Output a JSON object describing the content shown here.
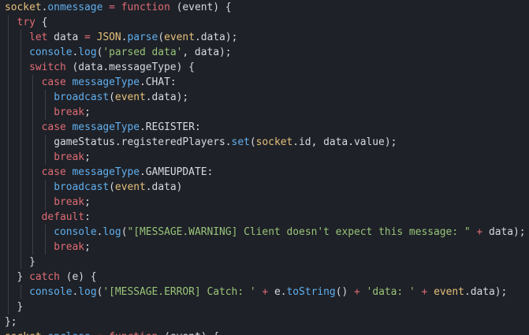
{
  "editor": {
    "language": "javascript",
    "colors": {
      "background": "#1e2127",
      "keyword": "#e06c75",
      "function": "#61afef",
      "object": "#e5c07b",
      "string": "#98c379",
      "text": "#d7dae0",
      "indent_guide": "#3b4048"
    },
    "lines": [
      {
        "indent": 0,
        "tokens": [
          {
            "t": "socket",
            "k": "obj"
          },
          {
            "t": ".",
            "k": "punc"
          },
          {
            "t": "onmessage",
            "k": "prop"
          },
          {
            "t": " ",
            "k": "punc"
          },
          {
            "t": "=",
            "k": "op"
          },
          {
            "t": " ",
            "k": "punc"
          },
          {
            "t": "function",
            "k": "kw"
          },
          {
            "t": " (event) {",
            "k": "punc"
          }
        ]
      },
      {
        "indent": 1,
        "tokens": [
          {
            "t": "try",
            "k": "kw"
          },
          {
            "t": " {",
            "k": "punc"
          }
        ]
      },
      {
        "indent": 2,
        "tokens": [
          {
            "t": "let",
            "k": "kw"
          },
          {
            "t": " data ",
            "k": "var"
          },
          {
            "t": "=",
            "k": "op"
          },
          {
            "t": " ",
            "k": "punc"
          },
          {
            "t": "JSON",
            "k": "obj"
          },
          {
            "t": ".",
            "k": "punc"
          },
          {
            "t": "parse",
            "k": "fn"
          },
          {
            "t": "(",
            "k": "punc"
          },
          {
            "t": "event",
            "k": "obj"
          },
          {
            "t": ".data);",
            "k": "punc"
          }
        ]
      },
      {
        "indent": 2,
        "tokens": [
          {
            "t": "console",
            "k": "fn"
          },
          {
            "t": ".",
            "k": "punc"
          },
          {
            "t": "log",
            "k": "fn"
          },
          {
            "t": "(",
            "k": "punc"
          },
          {
            "t": "'parsed data'",
            "k": "str"
          },
          {
            "t": ", data);",
            "k": "punc"
          }
        ]
      },
      {
        "indent": 2,
        "tokens": [
          {
            "t": "switch",
            "k": "kw"
          },
          {
            "t": " (data.messageType) {",
            "k": "punc"
          }
        ]
      },
      {
        "indent": 3,
        "tokens": [
          {
            "t": "case",
            "k": "kw"
          },
          {
            "t": " ",
            "k": "punc"
          },
          {
            "t": "messageType",
            "k": "prop"
          },
          {
            "t": ".CHAT:",
            "k": "punc"
          }
        ]
      },
      {
        "indent": 4,
        "tokens": [
          {
            "t": "broadcast",
            "k": "fn"
          },
          {
            "t": "(",
            "k": "punc"
          },
          {
            "t": "event",
            "k": "obj"
          },
          {
            "t": ".data);",
            "k": "punc"
          }
        ]
      },
      {
        "indent": 4,
        "tokens": [
          {
            "t": "break",
            "k": "kw"
          },
          {
            "t": ";",
            "k": "punc"
          }
        ]
      },
      {
        "indent": 3,
        "tokens": [
          {
            "t": "case",
            "k": "kw"
          },
          {
            "t": " ",
            "k": "punc"
          },
          {
            "t": "messageType",
            "k": "prop"
          },
          {
            "t": ".REGISTER:",
            "k": "punc"
          }
        ]
      },
      {
        "indent": 4,
        "tokens": [
          {
            "t": "gameStatus.registeredPlayers.",
            "k": "var"
          },
          {
            "t": "set",
            "k": "fn"
          },
          {
            "t": "(",
            "k": "punc"
          },
          {
            "t": "socket",
            "k": "obj"
          },
          {
            "t": ".id, data.value);",
            "k": "punc"
          }
        ]
      },
      {
        "indent": 4,
        "tokens": [
          {
            "t": "break",
            "k": "kw"
          },
          {
            "t": ";",
            "k": "punc"
          }
        ]
      },
      {
        "indent": 3,
        "tokens": [
          {
            "t": "case",
            "k": "kw"
          },
          {
            "t": " ",
            "k": "punc"
          },
          {
            "t": "messageType",
            "k": "prop"
          },
          {
            "t": ".GAMEUPDATE:",
            "k": "punc"
          }
        ]
      },
      {
        "indent": 4,
        "tokens": [
          {
            "t": "broadcast",
            "k": "fn"
          },
          {
            "t": "(",
            "k": "punc"
          },
          {
            "t": "event",
            "k": "obj"
          },
          {
            "t": ".data)",
            "k": "punc"
          }
        ]
      },
      {
        "indent": 4,
        "tokens": [
          {
            "t": "break",
            "k": "kw"
          },
          {
            "t": ";",
            "k": "punc"
          }
        ]
      },
      {
        "indent": 3,
        "tokens": [
          {
            "t": "default",
            "k": "kw"
          },
          {
            "t": ":",
            "k": "punc"
          }
        ]
      },
      {
        "indent": 4,
        "tokens": [
          {
            "t": "console",
            "k": "fn"
          },
          {
            "t": ".",
            "k": "punc"
          },
          {
            "t": "log",
            "k": "fn"
          },
          {
            "t": "(",
            "k": "punc"
          },
          {
            "t": "\"[MESSAGE.WARNING] Client doesn't expect this message: \"",
            "k": "str"
          },
          {
            "t": " ",
            "k": "punc"
          },
          {
            "t": "+",
            "k": "op"
          },
          {
            "t": " data);",
            "k": "punc"
          }
        ]
      },
      {
        "indent": 4,
        "tokens": [
          {
            "t": "break",
            "k": "kw"
          },
          {
            "t": ";",
            "k": "punc"
          }
        ]
      },
      {
        "indent": 2,
        "tokens": [
          {
            "t": "}",
            "k": "punc"
          }
        ]
      },
      {
        "indent": 1,
        "tokens": [
          {
            "t": "} ",
            "k": "punc"
          },
          {
            "t": "catch",
            "k": "kw"
          },
          {
            "t": " (e) {",
            "k": "punc"
          }
        ]
      },
      {
        "indent": 2,
        "tokens": [
          {
            "t": "console",
            "k": "fn"
          },
          {
            "t": ".",
            "k": "punc"
          },
          {
            "t": "log",
            "k": "fn"
          },
          {
            "t": "(",
            "k": "punc"
          },
          {
            "t": "'[MESSAGE.ERROR] Catch: '",
            "k": "str"
          },
          {
            "t": " ",
            "k": "punc"
          },
          {
            "t": "+",
            "k": "op"
          },
          {
            "t": " e.",
            "k": "punc"
          },
          {
            "t": "toString",
            "k": "fn"
          },
          {
            "t": "() ",
            "k": "punc"
          },
          {
            "t": "+",
            "k": "op"
          },
          {
            "t": " ",
            "k": "punc"
          },
          {
            "t": "'data: '",
            "k": "str"
          },
          {
            "t": " ",
            "k": "punc"
          },
          {
            "t": "+",
            "k": "op"
          },
          {
            "t": " ",
            "k": "punc"
          },
          {
            "t": "event",
            "k": "obj"
          },
          {
            "t": ".data);",
            "k": "punc"
          }
        ]
      },
      {
        "indent": 1,
        "tokens": [
          {
            "t": "}",
            "k": "punc"
          }
        ]
      },
      {
        "indent": 0,
        "tokens": [
          {
            "t": "};",
            "k": "punc"
          }
        ]
      },
      {
        "indent": 0,
        "tokens": [
          {
            "t": "socket",
            "k": "obj"
          },
          {
            "t": ".",
            "k": "punc"
          },
          {
            "t": "onclose",
            "k": "prop"
          },
          {
            "t": " ",
            "k": "punc"
          },
          {
            "t": "=",
            "k": "op"
          },
          {
            "t": " ",
            "k": "punc"
          },
          {
            "t": "function",
            "k": "kw"
          },
          {
            "t": " (event) {",
            "k": "punc"
          }
        ]
      }
    ]
  }
}
